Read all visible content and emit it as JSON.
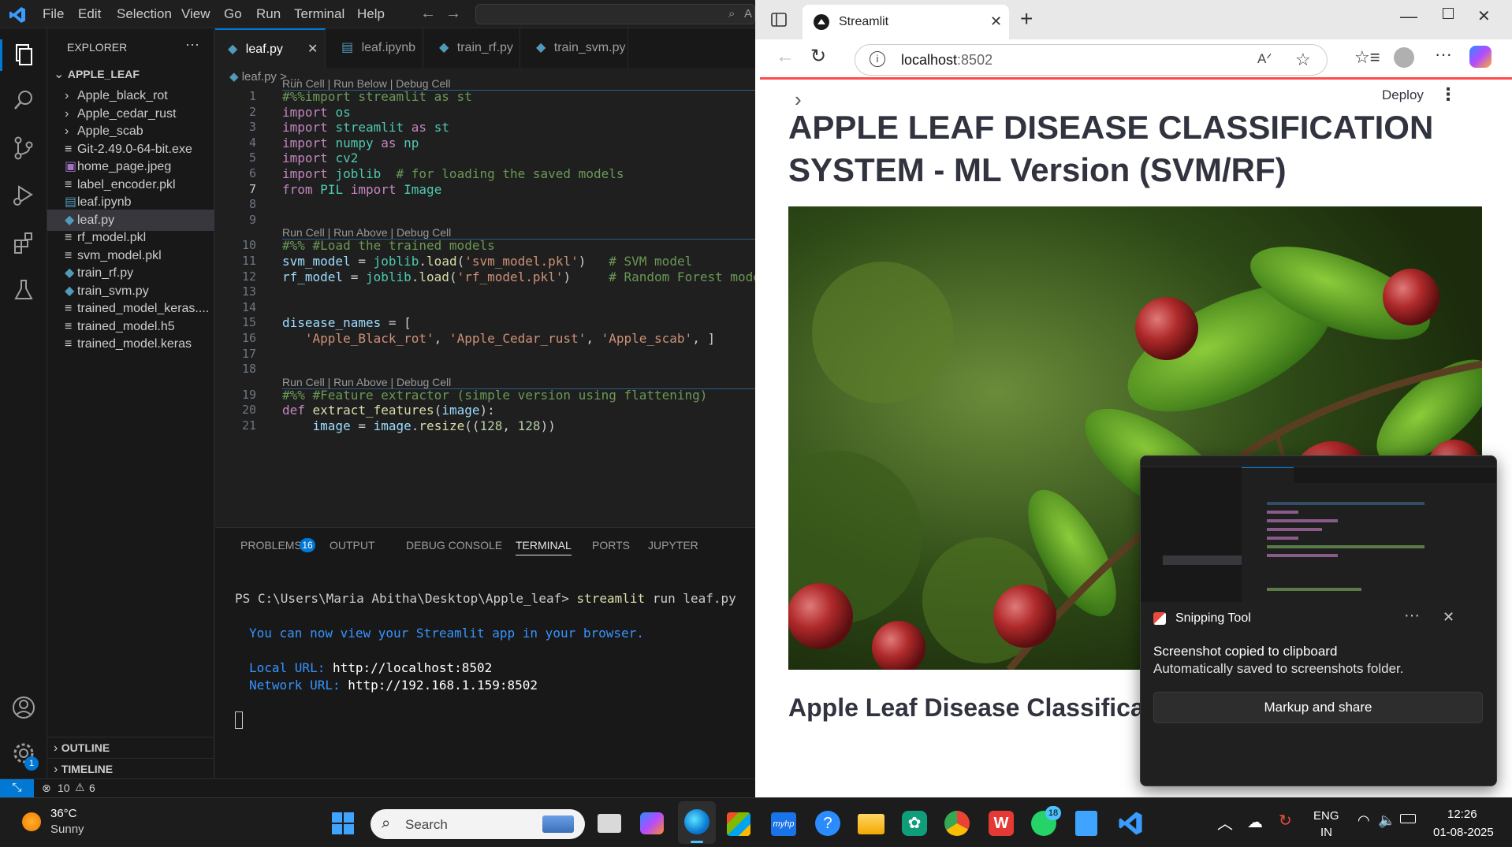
{
  "vscode": {
    "menu": [
      "File",
      "Edit",
      "Selection",
      "View",
      "Go",
      "Run",
      "Terminal",
      "Help"
    ],
    "search_placeholder": "A",
    "explorer": {
      "title": "EXPLORER",
      "root": "APPLE_LEAF",
      "items": [
        {
          "label": "Apple_black_rot",
          "type": "folder"
        },
        {
          "label": "Apple_cedar_rust",
          "type": "folder"
        },
        {
          "label": "Apple_scab",
          "type": "folder"
        },
        {
          "label": "Git-2.49.0-64-bit.exe",
          "type": "file"
        },
        {
          "label": "home_page.jpeg",
          "type": "image"
        },
        {
          "label": "label_encoder.pkl",
          "type": "file"
        },
        {
          "label": "leaf.ipynb",
          "type": "notebook"
        },
        {
          "label": "leaf.py",
          "type": "python",
          "selected": true
        },
        {
          "label": "rf_model.pkl",
          "type": "file"
        },
        {
          "label": "svm_model.pkl",
          "type": "file"
        },
        {
          "label": "train_rf.py",
          "type": "python"
        },
        {
          "label": "train_svm.py",
          "type": "python"
        },
        {
          "label": "trained_model_keras....",
          "type": "file"
        },
        {
          "label": "trained_model.h5",
          "type": "file"
        },
        {
          "label": "trained_model.keras",
          "type": "file"
        }
      ],
      "outline": "OUTLINE",
      "timeline": "TIMELINE"
    },
    "tabs": [
      "leaf.py",
      "leaf.ipynb",
      "train_rf.py",
      "train_svm.py"
    ],
    "breadcrumb": [
      "leaf.py",
      ">",
      "..."
    ],
    "code_lens": [
      "Run Cell | Run Below | Debug Cell",
      "Run Cell | Run Above | Debug Cell",
      "Run Cell | Run Above | Debug Cell"
    ],
    "line_numbers": [
      "1",
      "2",
      "3",
      "4",
      "5",
      "6",
      "7",
      "8",
      "9",
      "10",
      "11",
      "12",
      "13",
      "14",
      "15",
      "16",
      "17",
      "18",
      "19",
      "20",
      "21"
    ],
    "code": [
      "#%%import streamlit as st",
      "import os",
      "import streamlit as st",
      "import numpy as np",
      "import cv2",
      "import joblib  # for loading the saved models",
      "from PIL import Image",
      "",
      "",
      "#%% #Load the trained models",
      "svm_model = joblib.load('svm_model.pkl')   # SVM model",
      "rf_model = joblib.load('rf_model.pkl')     # Random Forest model",
      "",
      "",
      "disease_names = [",
      "   'Apple_Black_rot', 'Apple_Cedar_rust', 'Apple_scab', ]",
      "",
      "",
      "#%% #Feature extractor (simple version using flattening)",
      "def extract_features(image):",
      "    image = image.resize((128, 128))"
    ],
    "panel": {
      "tabs": [
        "PROBLEMS",
        "OUTPUT",
        "DEBUG CONSOLE",
        "TERMINAL",
        "PORTS",
        "JUPYTER"
      ],
      "problems_count": "16",
      "terminal": {
        "prompt": "PS C:\\Users\\Maria Abitha\\Desktop\\Apple_leaf> ",
        "command": "streamlit",
        "args": " run leaf.py",
        "info": "You can now view your Streamlit app in your browser.",
        "local_label": "Local URL: ",
        "local_url": "http://localhost:8502",
        "network_label": "Network URL: ",
        "network_url": "http://192.168.1.159:8502"
      }
    },
    "status": {
      "errors": "10",
      "warnings": "6"
    },
    "settings_badge": "1"
  },
  "browser": {
    "tab_title": "Streamlit",
    "address": "localhost:8502",
    "address_host": "localhost",
    "address_port": ":8502",
    "deploy": "Deploy",
    "heading": "APPLE LEAF DISEASE CLASSIFICATION SYSTEM - ML Version (SVM/RF)",
    "subheading": "Apple Leaf Disease Classification System"
  },
  "toast": {
    "app": "Snipping Tool",
    "title": "Screenshot copied to clipboard",
    "body": "Automatically saved to screenshots folder.",
    "button": "Markup and share"
  },
  "taskbar": {
    "weather_temp": "36°C",
    "weather_desc": "Sunny",
    "search": "Search",
    "whatsapp_badge": "18",
    "lang": "ENG",
    "region": "IN",
    "time": "12:26",
    "date": "01-08-2025"
  },
  "colors": {
    "accent": "#0078d4",
    "streamlit_red": "#ff4b4b",
    "status_bar_remote": "#0078d4"
  }
}
